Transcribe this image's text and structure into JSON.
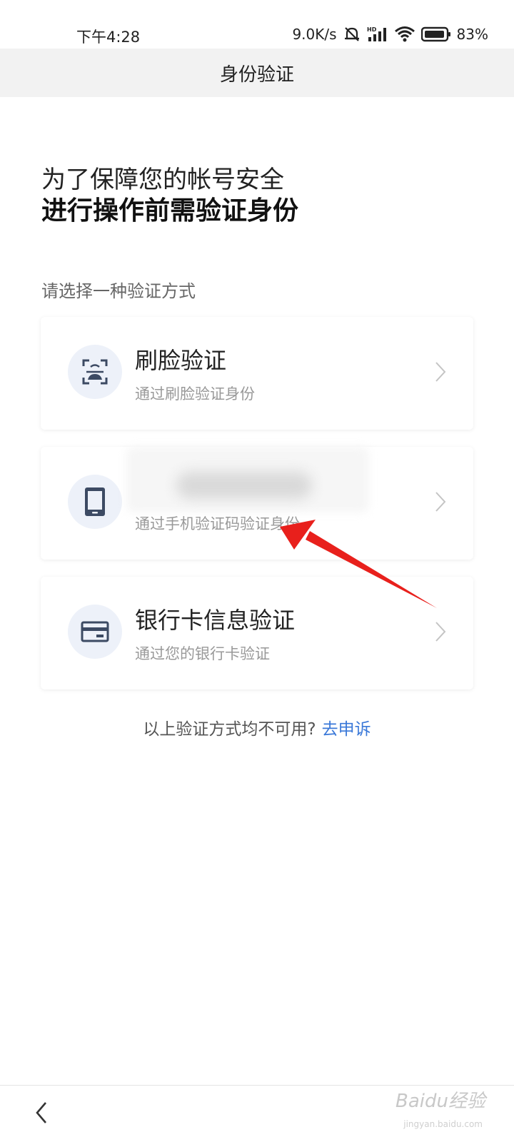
{
  "status": {
    "time": "下午4:28",
    "net_speed": "9.0K/s",
    "battery": "83%"
  },
  "nav": {
    "title": "身份验证"
  },
  "headline": {
    "line1": "为了保障您的帐号安全",
    "line2": "进行操作前需验证身份"
  },
  "prompt": "请选择一种验证方式",
  "options": [
    {
      "title": "刷脸验证",
      "subtitle": "通过刷脸验证身份",
      "icon": "face-scan-icon"
    },
    {
      "title": "",
      "subtitle": "通过手机验证码验证身份",
      "icon": "phone-icon"
    },
    {
      "title": "银行卡信息验证",
      "subtitle": "通过您的银行卡验证",
      "icon": "bank-card-icon"
    }
  ],
  "appeal": {
    "text": "以上验证方式均不可用?",
    "link": "去申诉"
  },
  "watermark": {
    "brand": "Baidu经验",
    "url": "jingyan.baidu.com"
  },
  "colors": {
    "accent": "#3a78d8",
    "icon_bg": "#edf1f9",
    "icon_fg": "#3c4a63",
    "arrow": "#e8201c"
  }
}
